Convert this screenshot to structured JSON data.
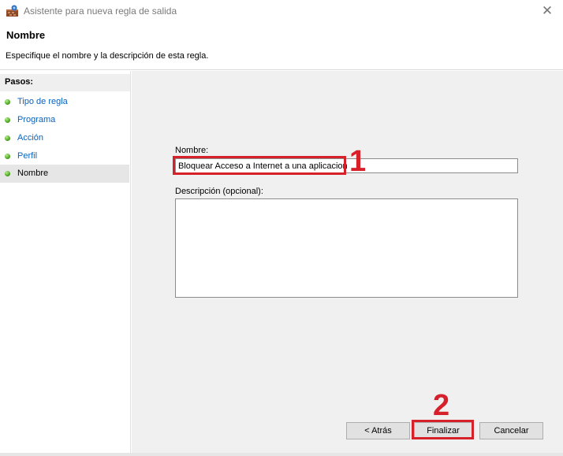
{
  "window": {
    "title": "Asistente para nueva regla de salida",
    "app_icon": "firewall-wizard-icon",
    "close_glyph": "✕"
  },
  "header": {
    "title": "Nombre",
    "description": "Especifique el nombre y la descripción de esta regla."
  },
  "steps": {
    "heading": "Pasos:",
    "items": [
      {
        "label": "Tipo de regla",
        "active": false
      },
      {
        "label": "Programa",
        "active": false
      },
      {
        "label": "Acción",
        "active": false
      },
      {
        "label": "Perfil",
        "active": false
      },
      {
        "label": "Nombre",
        "active": true
      }
    ]
  },
  "form": {
    "name_label": "Nombre:",
    "name_value": "Bloquear Acceso a Internet a una aplicacion",
    "description_label": "Descripción (opcional):",
    "description_value": ""
  },
  "annotations": {
    "marker1": "1",
    "marker2": "2",
    "color": "#d6202a"
  },
  "buttons": {
    "back": "< Atrás",
    "finish": "Finalizar",
    "cancel": "Cancelar"
  }
}
